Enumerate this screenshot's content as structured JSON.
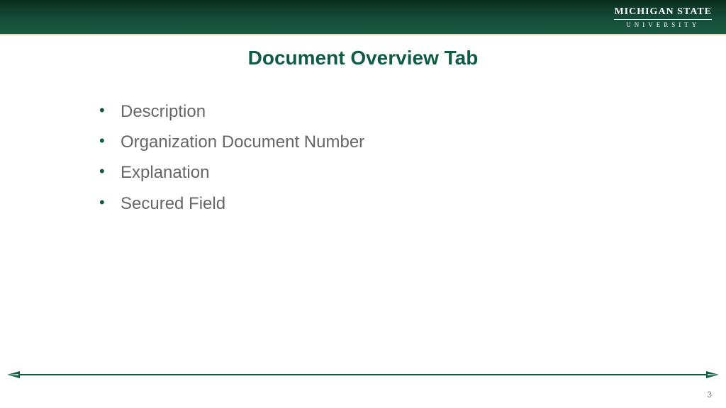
{
  "header": {
    "logo_main": "MICHIGAN STATE",
    "logo_sub": "UNIVERSITY"
  },
  "title": "Document Overview Tab",
  "bullets": [
    "Description",
    "Organization Document Number",
    "Explanation",
    "Secured Field"
  ],
  "page_number": "3",
  "colors": {
    "brand_green": "#0f5b45",
    "text_gray": "#666666"
  }
}
